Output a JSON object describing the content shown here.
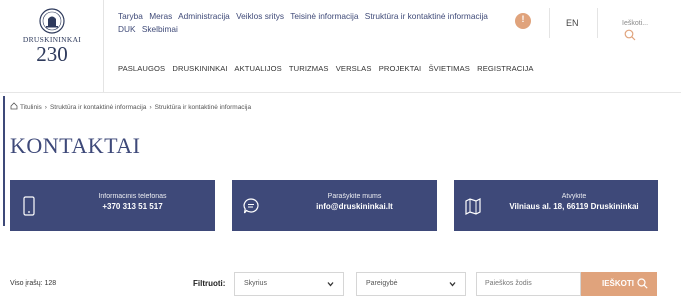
{
  "logo": {
    "name": "DRUSKININKAI",
    "year": "230"
  },
  "top_nav": [
    "Taryba",
    "Meras",
    "Administracija",
    "Veiklos sritys",
    "Teisinė informacija",
    "Struktūra ir kontaktinė informacija",
    "DUK",
    "Skelbimai"
  ],
  "header": {
    "info_icon": "!",
    "language": "EN",
    "search_label": "Ieškoti..."
  },
  "main_nav": [
    "PASLAUGOS",
    "DRUSKININKAI",
    "AKTUALIJOS",
    "TURIZMAS",
    "VERSLAS",
    "PROJEKTAI",
    "ŠVIETIMAS",
    "REGISTRACIJA"
  ],
  "breadcrumb": [
    "Titulinis",
    "Struktūra ir kontaktinė informacija",
    "Struktūra ir kontaktinė informacija"
  ],
  "page_title": "KONTAKTAI",
  "contact_cards": [
    {
      "label": "Informacinis telefonas",
      "value": "+370 313 51 517",
      "icon": "phone-icon"
    },
    {
      "label": "Parašykite mums",
      "value": "info@druskininkai.lt",
      "icon": "chat-icon"
    },
    {
      "label": "Atvykite",
      "value": "Vilniaus al. 18, 66119 Druskininkai",
      "icon": "map-icon"
    }
  ],
  "filters": {
    "total": "Viso įrašų: 128",
    "label": "Filtruoti:",
    "department": "Skyrius",
    "position": "Pareigybė",
    "keyword_placeholder": "Paieškos žodis",
    "search_button": "IEŠKOTI"
  },
  "colors": {
    "primary": "#3e4979",
    "accent": "#e0a37c"
  }
}
